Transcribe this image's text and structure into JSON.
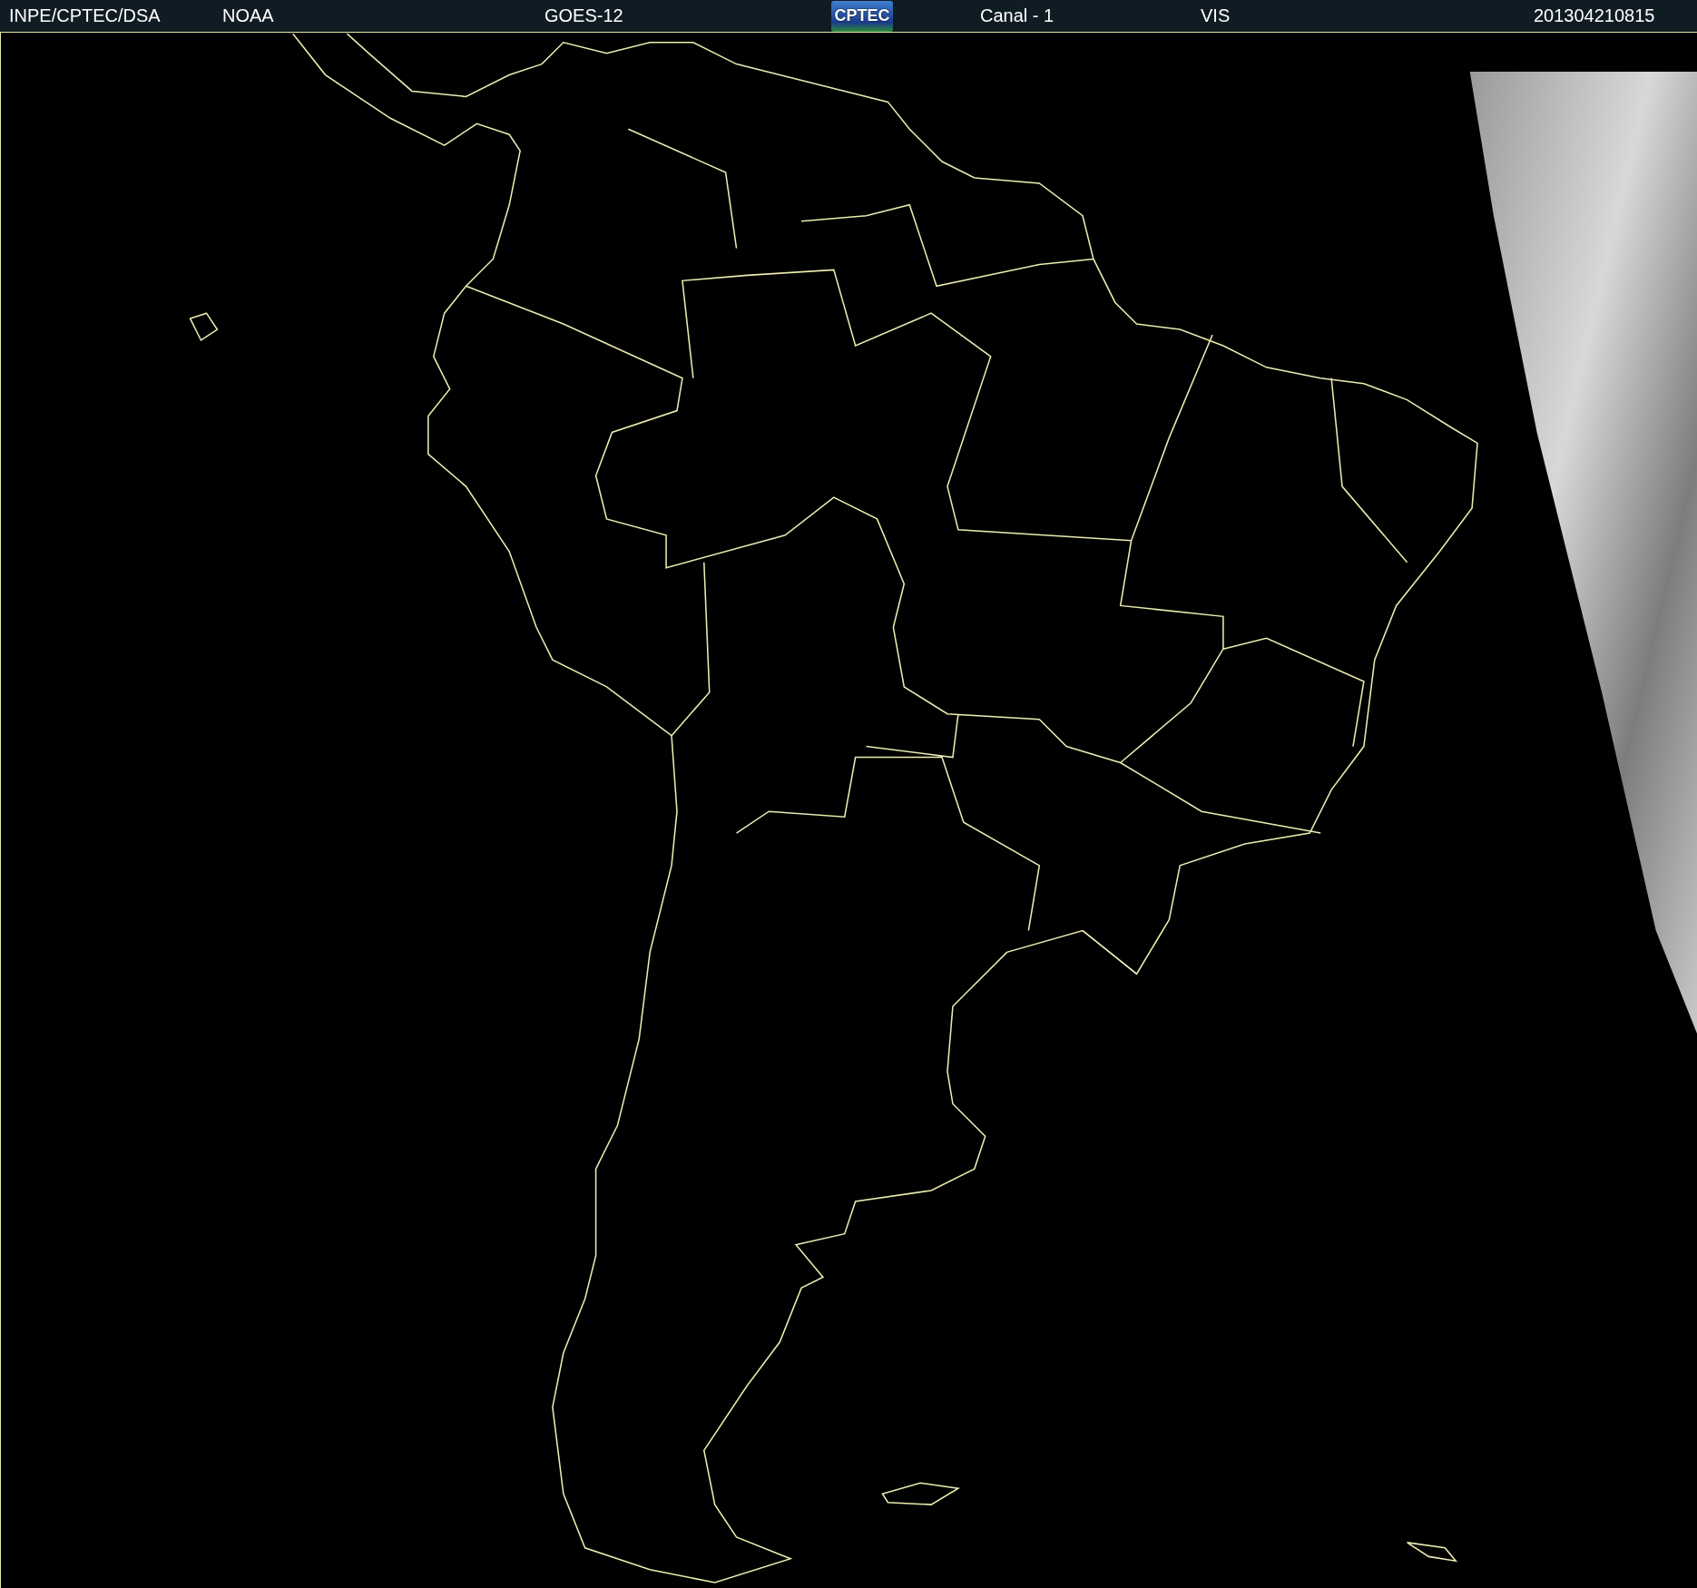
{
  "header": {
    "items": [
      {
        "kind": "text",
        "text": "INPE/CPTEC/DSA"
      },
      {
        "kind": "text",
        "text": "NOAA"
      },
      {
        "kind": "text",
        "text": "GOES-12"
      },
      {
        "kind": "logo",
        "text": "CPTEC"
      },
      {
        "kind": "text",
        "text": "Canal - 1"
      },
      {
        "kind": "text",
        "text": "VIS"
      },
      {
        "kind": "text",
        "text": "201304210815"
      }
    ]
  }
}
